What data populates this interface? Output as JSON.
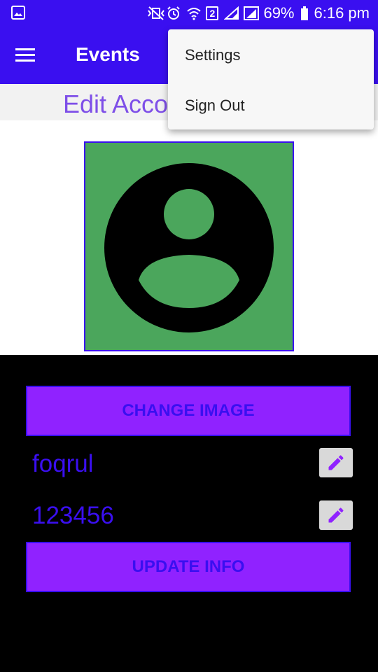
{
  "status_bar": {
    "battery_percent": "69%",
    "time": "6:16 pm",
    "sim_slot": "2",
    "icons": [
      "gallery-notification-icon",
      "vibrate-silent-icon",
      "alarm-icon",
      "wifi-icon",
      "sim-2-icon",
      "signal-icon",
      "signal-icon",
      "battery-icon"
    ]
  },
  "app_bar": {
    "title": "Events",
    "menu_icon": "hamburger-menu-icon"
  },
  "page": {
    "title": "Edit Account"
  },
  "profile": {
    "avatar_icon": "account-circle-icon",
    "avatar_bg_color": "#4ba65c"
  },
  "buttons": {
    "change_image": "CHANGE IMAGE",
    "update_info": "UPDATE INFO"
  },
  "fields": {
    "username": "foqrul",
    "password": "123456",
    "edit_icon": "pencil-icon"
  },
  "overflow_menu": {
    "items": [
      "Settings",
      "Sign Out"
    ]
  },
  "colors": {
    "primary": "#3a0ff0",
    "accent": "#9022ff",
    "title": "#7e4fe8"
  }
}
